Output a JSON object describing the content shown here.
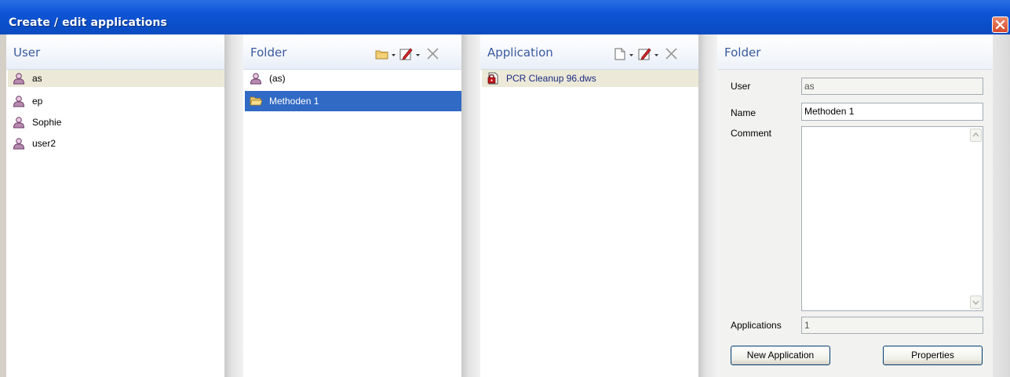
{
  "window": {
    "title": "Create / edit applications"
  },
  "user_panel": {
    "title": "User",
    "items": [
      {
        "label": "as",
        "icon": "user-icon",
        "selected": true
      },
      {
        "label": "ep",
        "icon": "user-icon",
        "selected": false
      },
      {
        "label": "Sophie",
        "icon": "user-icon",
        "selected": false
      },
      {
        "label": "user2",
        "icon": "user-icon",
        "selected": false
      }
    ]
  },
  "folder_panel": {
    "title": "Folder",
    "toolbar": [
      "new-folder-icon",
      "edit-icon",
      "delete-icon"
    ],
    "items": [
      {
        "label": "(as)",
        "icon": "user-icon",
        "selected": false
      },
      {
        "label": "Methoden 1",
        "icon": "open-folder-icon",
        "selected": true
      }
    ]
  },
  "application_panel": {
    "title": "Application",
    "toolbar": [
      "new-document-icon",
      "edit-icon",
      "delete-icon"
    ],
    "items": [
      {
        "label": "PCR Cleanup 96.dws",
        "icon": "locked-document-icon",
        "selected": true
      }
    ]
  },
  "details_panel": {
    "title": "Folder",
    "user_label": "User",
    "user_value": "as",
    "name_label": "Name",
    "name_value": "Methoden 1",
    "comment_label": "Comment",
    "comment_value": "",
    "applications_label": "Applications",
    "applications_value": "1",
    "new_application_button": "New Application",
    "properties_button": "Properties"
  },
  "colors": {
    "title_bar": "#0a4ec9",
    "panel_title": "#3a5aa0",
    "selection_dark": "#316ac5",
    "selection_light": "#ece9d8"
  }
}
